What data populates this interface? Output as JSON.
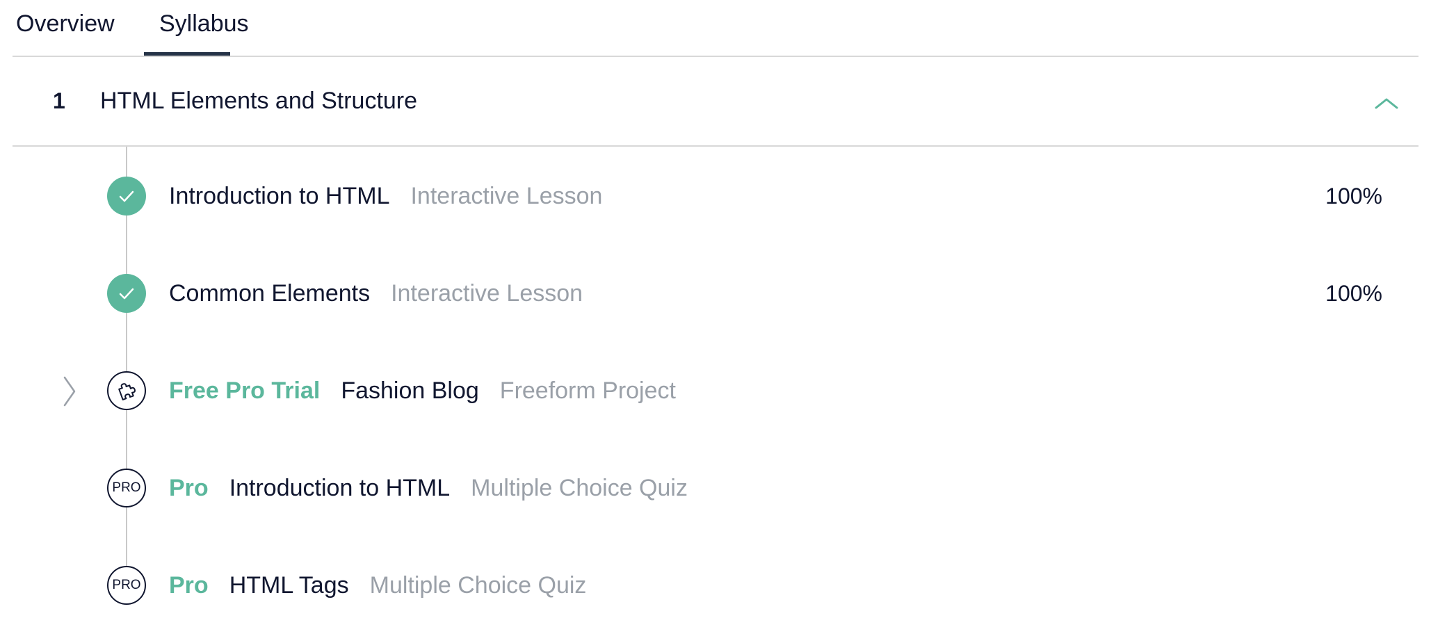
{
  "tabs": [
    {
      "label": "Overview",
      "active": false
    },
    {
      "label": "Syllabus",
      "active": true
    }
  ],
  "module": {
    "number": "1",
    "title": "HTML Elements and Structure",
    "expanded": true
  },
  "items": [
    {
      "tag": "",
      "name": "Introduction to HTML",
      "type": "Interactive Lesson",
      "progress": "100%",
      "status": "complete",
      "icon": "check-icon"
    },
    {
      "tag": "",
      "name": "Common Elements",
      "type": "Interactive Lesson",
      "progress": "100%",
      "status": "complete",
      "icon": "check-icon"
    },
    {
      "tag": "Free Pro Trial",
      "name": "Fashion Blog",
      "type": "Freeform Project",
      "progress": "",
      "status": "locked",
      "icon": "puzzle-icon"
    },
    {
      "tag": "Pro",
      "name": "Introduction to HTML",
      "type": "Multiple Choice Quiz",
      "progress": "",
      "status": "pro",
      "icon": "pro-icon",
      "badge": "PRO"
    },
    {
      "tag": "Pro",
      "name": "HTML Tags",
      "type": "Multiple Choice Quiz",
      "progress": "",
      "status": "pro",
      "icon": "pro-icon",
      "badge": "PRO"
    }
  ],
  "colors": {
    "accent": "#5bb79c",
    "text": "#10162f",
    "muted": "#9aa0a8",
    "divider": "#d8d8d8"
  }
}
